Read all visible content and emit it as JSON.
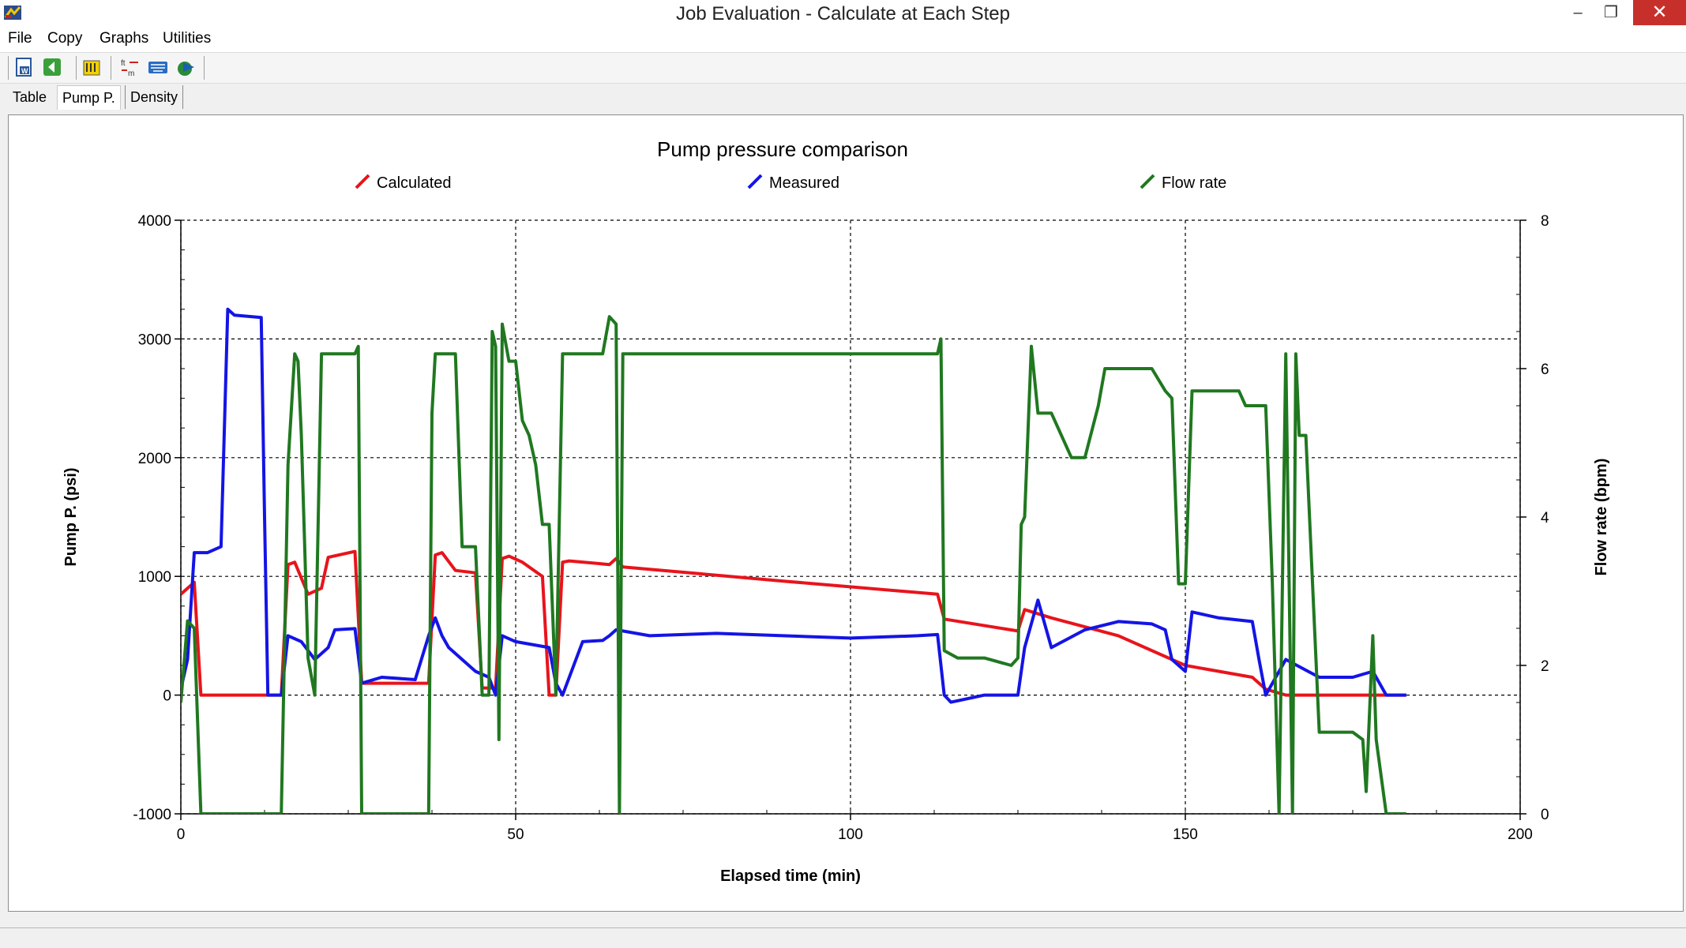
{
  "window": {
    "title": "Job Evaluation - Calculate at Each Step",
    "min_glyph": "–",
    "max_glyph": "❐",
    "close_glyph": "✕"
  },
  "menu": {
    "items": [
      "File",
      "Copy",
      "Graphs",
      "Utilities"
    ]
  },
  "toolbar": {
    "buttons": [
      "export-word-icon",
      "back-icon",
      "units-icon",
      "ft-m-convert-icon",
      "keyboard-icon",
      "run-icon"
    ]
  },
  "tabs": {
    "items": [
      "Table",
      "Pump P.",
      "Density"
    ],
    "active": "Pump P."
  },
  "colors": {
    "calculated": "#e8141c",
    "measured": "#1414e6",
    "flow_rate": "#207820"
  },
  "chart_data": {
    "type": "line",
    "title": "Pump pressure comparison",
    "xlabel": "Elapsed time (min)",
    "ylabel": "Pump P. (psi)",
    "y2label": "Flow rate (bpm)",
    "xlim": [
      0,
      200
    ],
    "ylim": [
      -1000,
      4000
    ],
    "y2lim": [
      0,
      8
    ],
    "x_ticks": [
      0,
      50,
      100,
      150,
      200
    ],
    "y_ticks": [
      -1000,
      0,
      1000,
      2000,
      3000,
      4000
    ],
    "y2_ticks": [
      0,
      2,
      4,
      6,
      8
    ],
    "grid": true,
    "legend": "top",
    "series": [
      {
        "name": "Calculated",
        "axis": "left",
        "color": "#e8141c",
        "x": [
          0,
          1,
          2,
          3,
          15,
          16,
          17,
          19,
          21,
          22,
          26,
          27,
          37,
          38,
          39,
          41,
          44,
          45,
          47,
          48,
          49,
          51,
          54,
          55,
          56,
          57,
          58,
          64,
          65,
          66,
          70,
          90,
          113,
          114,
          125,
          126,
          130,
          140,
          150,
          160,
          162,
          165,
          170,
          183
        ],
        "y": [
          850,
          900,
          950,
          0,
          0,
          1100,
          1120,
          850,
          900,
          1160,
          1210,
          100,
          100,
          1180,
          1200,
          1050,
          1030,
          60,
          60,
          1150,
          1170,
          1120,
          1000,
          0,
          0,
          1120,
          1130,
          1100,
          1150,
          1080,
          1060,
          960,
          850,
          640,
          540,
          720,
          650,
          500,
          250,
          150,
          50,
          0,
          0,
          0
        ]
      },
      {
        "name": "Measured",
        "axis": "left",
        "color": "#1414e6",
        "x": [
          0,
          1,
          2,
          3,
          4,
          6,
          7,
          8,
          12,
          12.5,
          13,
          15,
          16,
          18,
          20,
          22,
          23,
          26,
          27,
          30,
          35,
          37,
          38,
          39,
          40,
          42,
          44,
          46,
          47,
          48,
          50,
          55,
          56,
          57,
          60,
          63,
          64,
          65,
          70,
          80,
          90,
          100,
          110,
          113,
          114,
          115,
          120,
          125,
          126,
          128,
          130,
          135,
          140,
          145,
          147,
          148,
          150,
          151,
          155,
          160,
          161,
          162,
          165,
          170,
          175,
          178,
          180,
          183
        ],
        "y": [
          50,
          300,
          1200,
          1200,
          1200,
          1250,
          3250,
          3200,
          3180,
          1500,
          0,
          0,
          500,
          450,
          300,
          400,
          550,
          560,
          100,
          150,
          130,
          500,
          650,
          500,
          400,
          300,
          200,
          150,
          0,
          500,
          450,
          400,
          100,
          0,
          450,
          460,
          500,
          550,
          500,
          520,
          500,
          480,
          500,
          510,
          0,
          -60,
          0,
          0,
          400,
          800,
          400,
          550,
          620,
          600,
          550,
          300,
          200,
          700,
          650,
          620,
          300,
          0,
          300,
          150,
          150,
          200,
          0,
          0
        ]
      },
      {
        "name": "Flow rate",
        "axis": "right",
        "color": "#207820",
        "x": [
          0,
          1,
          2,
          3,
          10,
          15,
          16,
          17,
          17.5,
          18,
          19,
          20,
          21,
          22,
          26,
          26.5,
          27,
          30,
          37,
          37.5,
          38,
          41,
          42,
          44,
          45,
          46,
          46.5,
          47,
          47.5,
          48,
          49,
          50,
          51,
          52,
          53,
          54,
          55,
          56,
          57,
          60,
          63,
          64,
          65,
          65.5,
          66,
          113,
          113.5,
          114,
          116,
          120,
          124,
          125,
          125.5,
          126,
          127,
          128,
          130,
          133,
          135,
          137,
          138,
          140,
          145,
          147,
          148,
          149,
          150,
          151,
          155,
          158,
          159,
          162,
          163,
          164,
          165,
          166,
          166.5,
          167,
          168,
          170,
          172,
          175,
          176.5,
          177,
          178,
          178.5,
          180,
          183
        ],
        "y": [
          1.5,
          2.6,
          2.5,
          0,
          0,
          0,
          4.7,
          6.2,
          6.1,
          5.1,
          2.1,
          1.6,
          6.2,
          6.2,
          6.2,
          6.3,
          0,
          0,
          0,
          5.4,
          6.2,
          6.2,
          3.6,
          3.6,
          1.6,
          1.6,
          6.5,
          6.3,
          1.0,
          6.6,
          6.1,
          6.1,
          5.3,
          5.1,
          4.7,
          3.9,
          3.9,
          1.6,
          6.2,
          6.2,
          6.2,
          6.7,
          6.6,
          0,
          6.2,
          6.2,
          6.4,
          2.2,
          2.1,
          2.1,
          2.0,
          2.1,
          3.9,
          4.0,
          6.3,
          5.4,
          5.4,
          4.8,
          4.8,
          5.5,
          6.0,
          6.0,
          6.0,
          5.7,
          5.6,
          3.1,
          3.1,
          5.7,
          5.7,
          5.7,
          5.5,
          5.5,
          3.1,
          0,
          6.2,
          0.0,
          6.2,
          5.1,
          5.1,
          1.1,
          1.1,
          1.1,
          1.0,
          0.3,
          2.4,
          1.0,
          0,
          0
        ]
      }
    ]
  }
}
